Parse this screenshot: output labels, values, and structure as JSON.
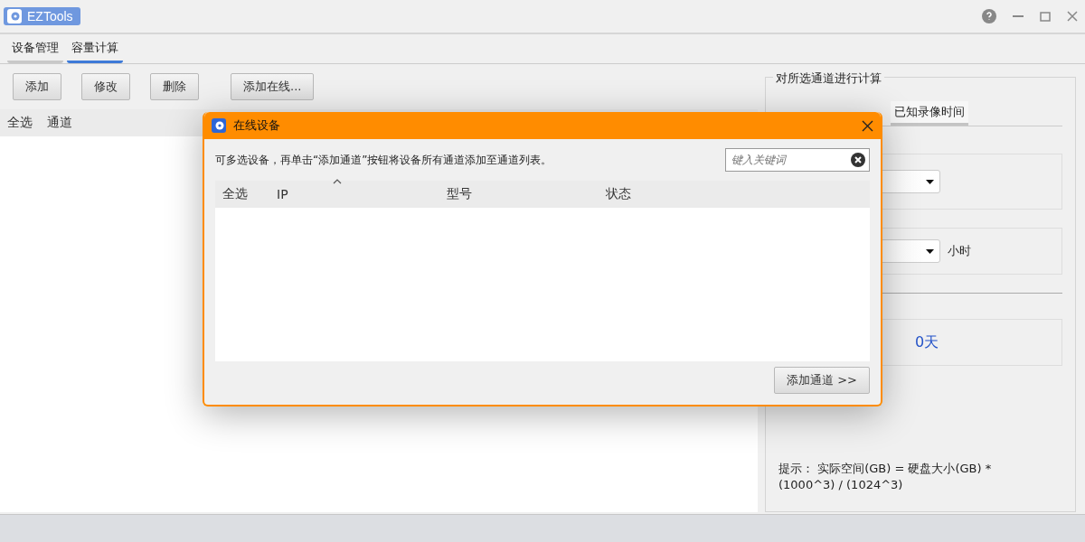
{
  "window": {
    "title": "EZTools"
  },
  "tabs": [
    {
      "label": "设备管理",
      "selected": false
    },
    {
      "label": "容量计算",
      "selected": true
    }
  ],
  "toolbar": [
    "添加",
    "修改",
    "删除",
    "添加在线..."
  ],
  "channel_table": {
    "columns": [
      "全选",
      "通道"
    ]
  },
  "calc_panel": {
    "title": "对所选通道进行计算",
    "tabs": [
      {
        "label": "已知录像时间",
        "selected": true
      }
    ],
    "hours_unit": "小时",
    "result": "0天",
    "hint": "提示：  实际空间(GB) = 硬盘大小(GB) * (1000^3) / (1024^3)"
  },
  "dialog": {
    "title": "在线设备",
    "instruction": "可多选设备，再单击“添加通道”按钮将设备所有通道添加至通道列表。",
    "search": {
      "placeholder": "键入关键词"
    },
    "columns": [
      "全选",
      "IP",
      "型号",
      "状态"
    ],
    "button": "添加通道 >>"
  }
}
